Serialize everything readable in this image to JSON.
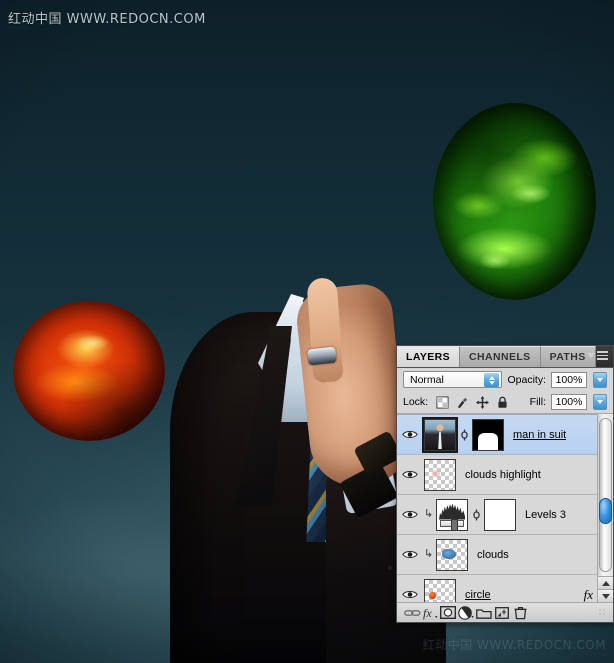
{
  "watermarks": {
    "top": "红动中国 WWW.REDOCN.COM",
    "bottom": "红动中国 WWW.REDOCN.COM"
  },
  "artwork": {
    "description": "Headless man in dark suit with blue striped tie raising index finger, two planets on dark teal background",
    "background_color": "#16313c",
    "green_planet_color": "#2f9b14",
    "red_planet_color": "#f2500c",
    "suit_color": "#0e0b0c",
    "tie_colors": [
      "#123257",
      "#4f9ed6",
      "#c9a233"
    ]
  },
  "panel": {
    "tabs": [
      {
        "label": "LAYERS",
        "active": true
      },
      {
        "label": "CHANNELS",
        "active": false
      },
      {
        "label": "PATHS",
        "active": false
      }
    ],
    "menu_icon": "panel-menu-icon",
    "blend_mode": {
      "value": "Normal",
      "icon": "spinner-icon"
    },
    "opacity": {
      "label": "Opacity:",
      "value": "100%"
    },
    "lock": {
      "label": "Lock:",
      "icons": [
        "lock-transparent-pixels-icon",
        "lock-image-pixels-icon",
        "lock-position-icon",
        "lock-all-icon"
      ]
    },
    "fill": {
      "label": "Fill:",
      "value": "100%"
    },
    "layers": [
      {
        "name": "man in suit",
        "visible": true,
        "selected": true,
        "underlined": true,
        "clipped": false,
        "thumb": "photo",
        "mask": "bw-mask",
        "linked": true,
        "fx": false
      },
      {
        "name": "clouds highlight",
        "visible": true,
        "selected": false,
        "underlined": false,
        "clipped": false,
        "thumb": "transparent",
        "mask": null,
        "linked": false,
        "fx": false
      },
      {
        "name": "Levels 3",
        "visible": true,
        "selected": false,
        "underlined": false,
        "clipped": true,
        "thumb": "histogram",
        "mask": "white-mask",
        "linked": true,
        "fx": false
      },
      {
        "name": "clouds",
        "visible": true,
        "selected": false,
        "underlined": false,
        "clipped": true,
        "thumb": "clouds",
        "mask": null,
        "linked": false,
        "fx": false
      },
      {
        "name": "circle",
        "visible": true,
        "selected": false,
        "underlined": true,
        "clipped": false,
        "thumb": "circle",
        "mask": null,
        "linked": false,
        "fx": true,
        "fx_label": "fx"
      }
    ],
    "footer_buttons": [
      "link-layers-icon",
      "add-layer-style-icon",
      "add-layer-mask-icon",
      "new-adjustment-layer-icon",
      "new-group-icon",
      "new-layer-icon",
      "delete-layer-icon"
    ],
    "scrollbar": {
      "name": "layers-scrollbar"
    }
  },
  "colors": {
    "selection_blue": "#c5d9f3",
    "panel_gray": "#d6d6d6",
    "accent_blue": "#3c96e0"
  }
}
